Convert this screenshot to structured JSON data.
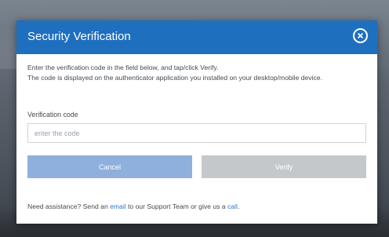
{
  "dialog": {
    "title": "Security Verification",
    "close_icon": "close-icon",
    "instructions": {
      "line1": "Enter the verification code in the field below, and tap/click Verify.",
      "line2": "The code is displayed on the authenticator application you installed on your desktop/mobile device."
    },
    "field": {
      "label": "Verification code",
      "placeholder": "enter the code",
      "value": ""
    },
    "buttons": {
      "cancel_label": "Cancel",
      "verify_label": "Verify"
    },
    "assistance": {
      "prefix": "Need assistance? Send an ",
      "email_link": "email",
      "middle": " to our Support Team or give us a ",
      "call_link": "call",
      "suffix": "."
    }
  },
  "colors": {
    "header": "#1f6fbf",
    "cancel_button": "#8fb0dd",
    "verify_button_disabled": "#c5c8cb",
    "link": "#2d79c7"
  }
}
